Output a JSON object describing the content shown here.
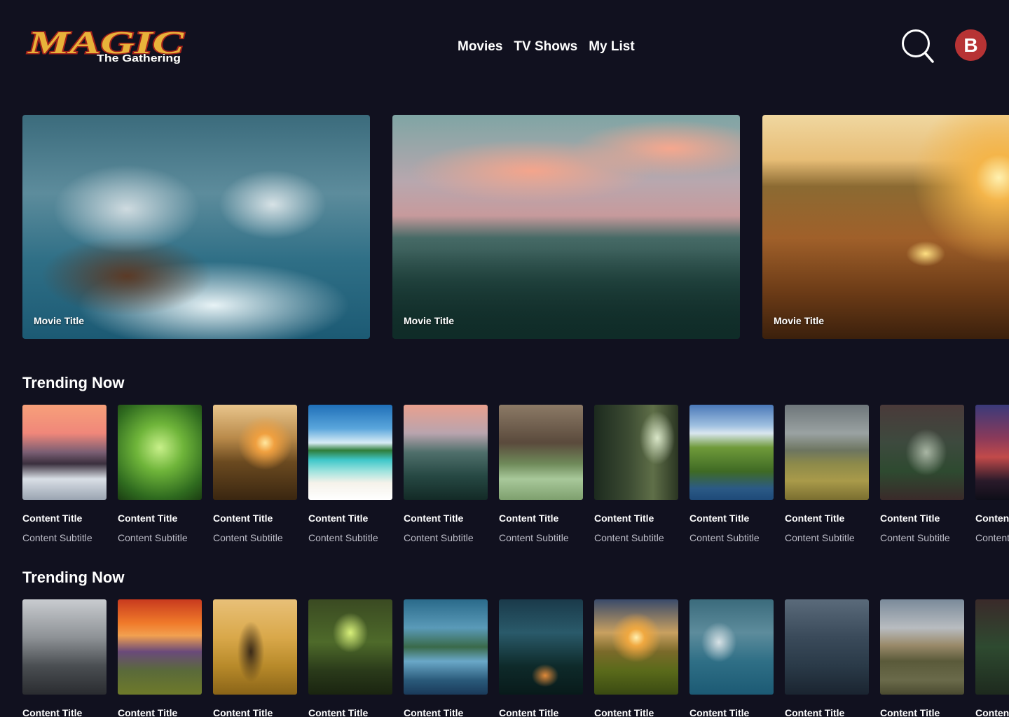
{
  "header": {
    "logo_main": "MAGIC",
    "logo_sub": "The Gathering",
    "nav": [
      "Movies",
      "TV Shows",
      "My List"
    ],
    "avatar_initial": "B"
  },
  "hero": [
    {
      "title": "Movie Title"
    },
    {
      "title": "Movie Title"
    },
    {
      "title": "Movie Title"
    }
  ],
  "sections": [
    {
      "title": "Trending Now",
      "items": [
        {
          "title": "Content Title",
          "subtitle": "Content Subtitle"
        },
        {
          "title": "Content Title",
          "subtitle": "Content Subtitle"
        },
        {
          "title": "Content Title",
          "subtitle": "Content Subtitle"
        },
        {
          "title": "Content Title",
          "subtitle": "Content Subtitle"
        },
        {
          "title": "Content Title",
          "subtitle": "Content Subtitle"
        },
        {
          "title": "Content Title",
          "subtitle": "Content Subtitle"
        },
        {
          "title": "Content Title",
          "subtitle": "Content Subtitle"
        },
        {
          "title": "Content Title",
          "subtitle": "Content Subtitle"
        },
        {
          "title": "Content Title",
          "subtitle": "Content Subtitle"
        },
        {
          "title": "Content Title",
          "subtitle": "Content Subtitle"
        },
        {
          "title": "Content Title",
          "subtitle": "Content Subtitle"
        }
      ]
    },
    {
      "title": "Trending Now",
      "items": [
        {
          "title": "Content Title"
        },
        {
          "title": "Content Title"
        },
        {
          "title": "Content Title"
        },
        {
          "title": "Content Title"
        },
        {
          "title": "Content Title"
        },
        {
          "title": "Content Title"
        },
        {
          "title": "Content Title"
        },
        {
          "title": "Content Title"
        },
        {
          "title": "Content Title"
        },
        {
          "title": "Content Title"
        },
        {
          "title": "Content Title"
        }
      ]
    }
  ],
  "colors": {
    "background": "#11111f",
    "avatar": "#b73334",
    "subtitle_text": "#bdbdc8",
    "logo_fill": "#e8b23a",
    "logo_outline": "#a3221b"
  },
  "icons": [
    "search-icon"
  ]
}
